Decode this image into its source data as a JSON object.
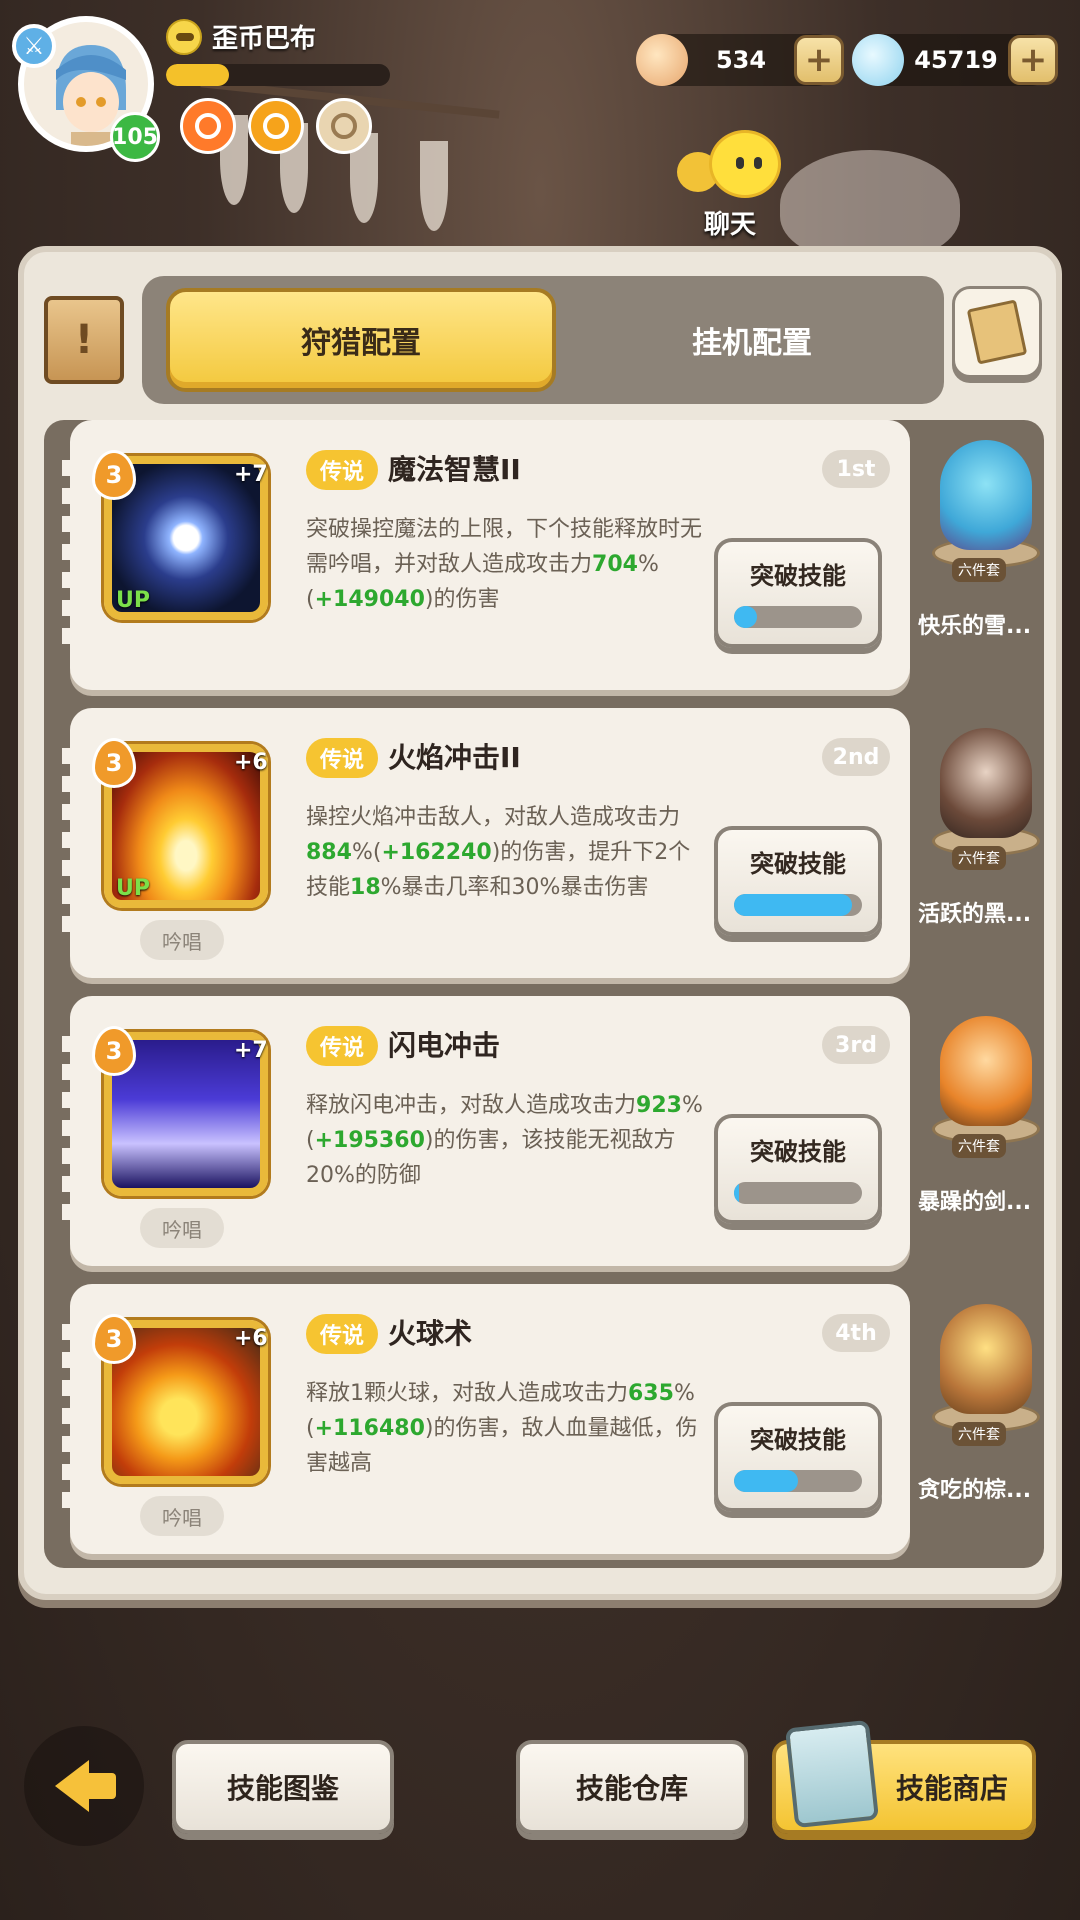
{
  "player": {
    "name": "歪币巴布",
    "level": "105"
  },
  "currency": {
    "shell": {
      "value": "534",
      "icon": "shell-icon"
    },
    "gem": {
      "value": "45719",
      "icon": "gem-shell-icon"
    },
    "plus_label": "+"
  },
  "chat": {
    "label": "聊天"
  },
  "tabs": {
    "hunt": "狩猎配置",
    "idle": "挂机配置"
  },
  "skills": [
    {
      "rarity": "传说",
      "name": "魔法智慧II",
      "rank": "1st",
      "level": "3",
      "plus": "+7",
      "up": "UP",
      "chant": "",
      "desc_parts": [
        "突破操控魔法的上限，下个技能释放时无需吟唱，并对敌人造成攻击力",
        "704",
        "%(",
        "+149040",
        ")的伤害"
      ],
      "button": "突破技能",
      "progress": 0.18,
      "set_name": "快乐的雪...",
      "set_tag": "六件套"
    },
    {
      "rarity": "传说",
      "name": "火焰冲击II",
      "rank": "2nd",
      "level": "3",
      "plus": "+6",
      "up": "UP",
      "chant": "吟唱",
      "desc_parts": [
        "操控火焰冲击敌人，对敌人造成攻击力",
        "884",
        "%(",
        "+162240",
        ")的伤害，提升下2个技能",
        "18",
        "%暴击几率和30%暴击伤害"
      ],
      "button": "突破技能",
      "progress": 0.92,
      "set_name": "活跃的黑...",
      "set_tag": "六件套"
    },
    {
      "rarity": "传说",
      "name": "闪电冲击",
      "rank": "3rd",
      "level": "3",
      "plus": "+7",
      "up": "",
      "chant": "吟唱",
      "desc_parts": [
        "释放闪电冲击，对敌人造成攻击力",
        "923",
        "%(",
        "+195360",
        ")的伤害，该技能无视敌方20%的防御"
      ],
      "button": "突破技能",
      "progress": 0.04,
      "set_name": "暴躁的剑...",
      "set_tag": "六件套"
    },
    {
      "rarity": "传说",
      "name": "火球术",
      "rank": "4th",
      "level": "3",
      "plus": "+6",
      "up": "",
      "chant": "吟唱",
      "desc_parts": [
        "释放1颗火球，对敌人造成攻击力",
        "635",
        "%(",
        "+116480",
        ")的伤害，敌人血量越低，伤害越高"
      ],
      "button": "突破技能",
      "progress": 0.5,
      "set_name": "贪吃的棕...",
      "set_tag": "六件套"
    }
  ],
  "bottom": {
    "codex": "技能图鉴",
    "storage": "技能仓库",
    "shop": "技能商店"
  },
  "colors": {
    "accent_yellow": "#f3c83c",
    "highlight_green": "#2da82f",
    "progress_blue": "#3fb9f2"
  }
}
